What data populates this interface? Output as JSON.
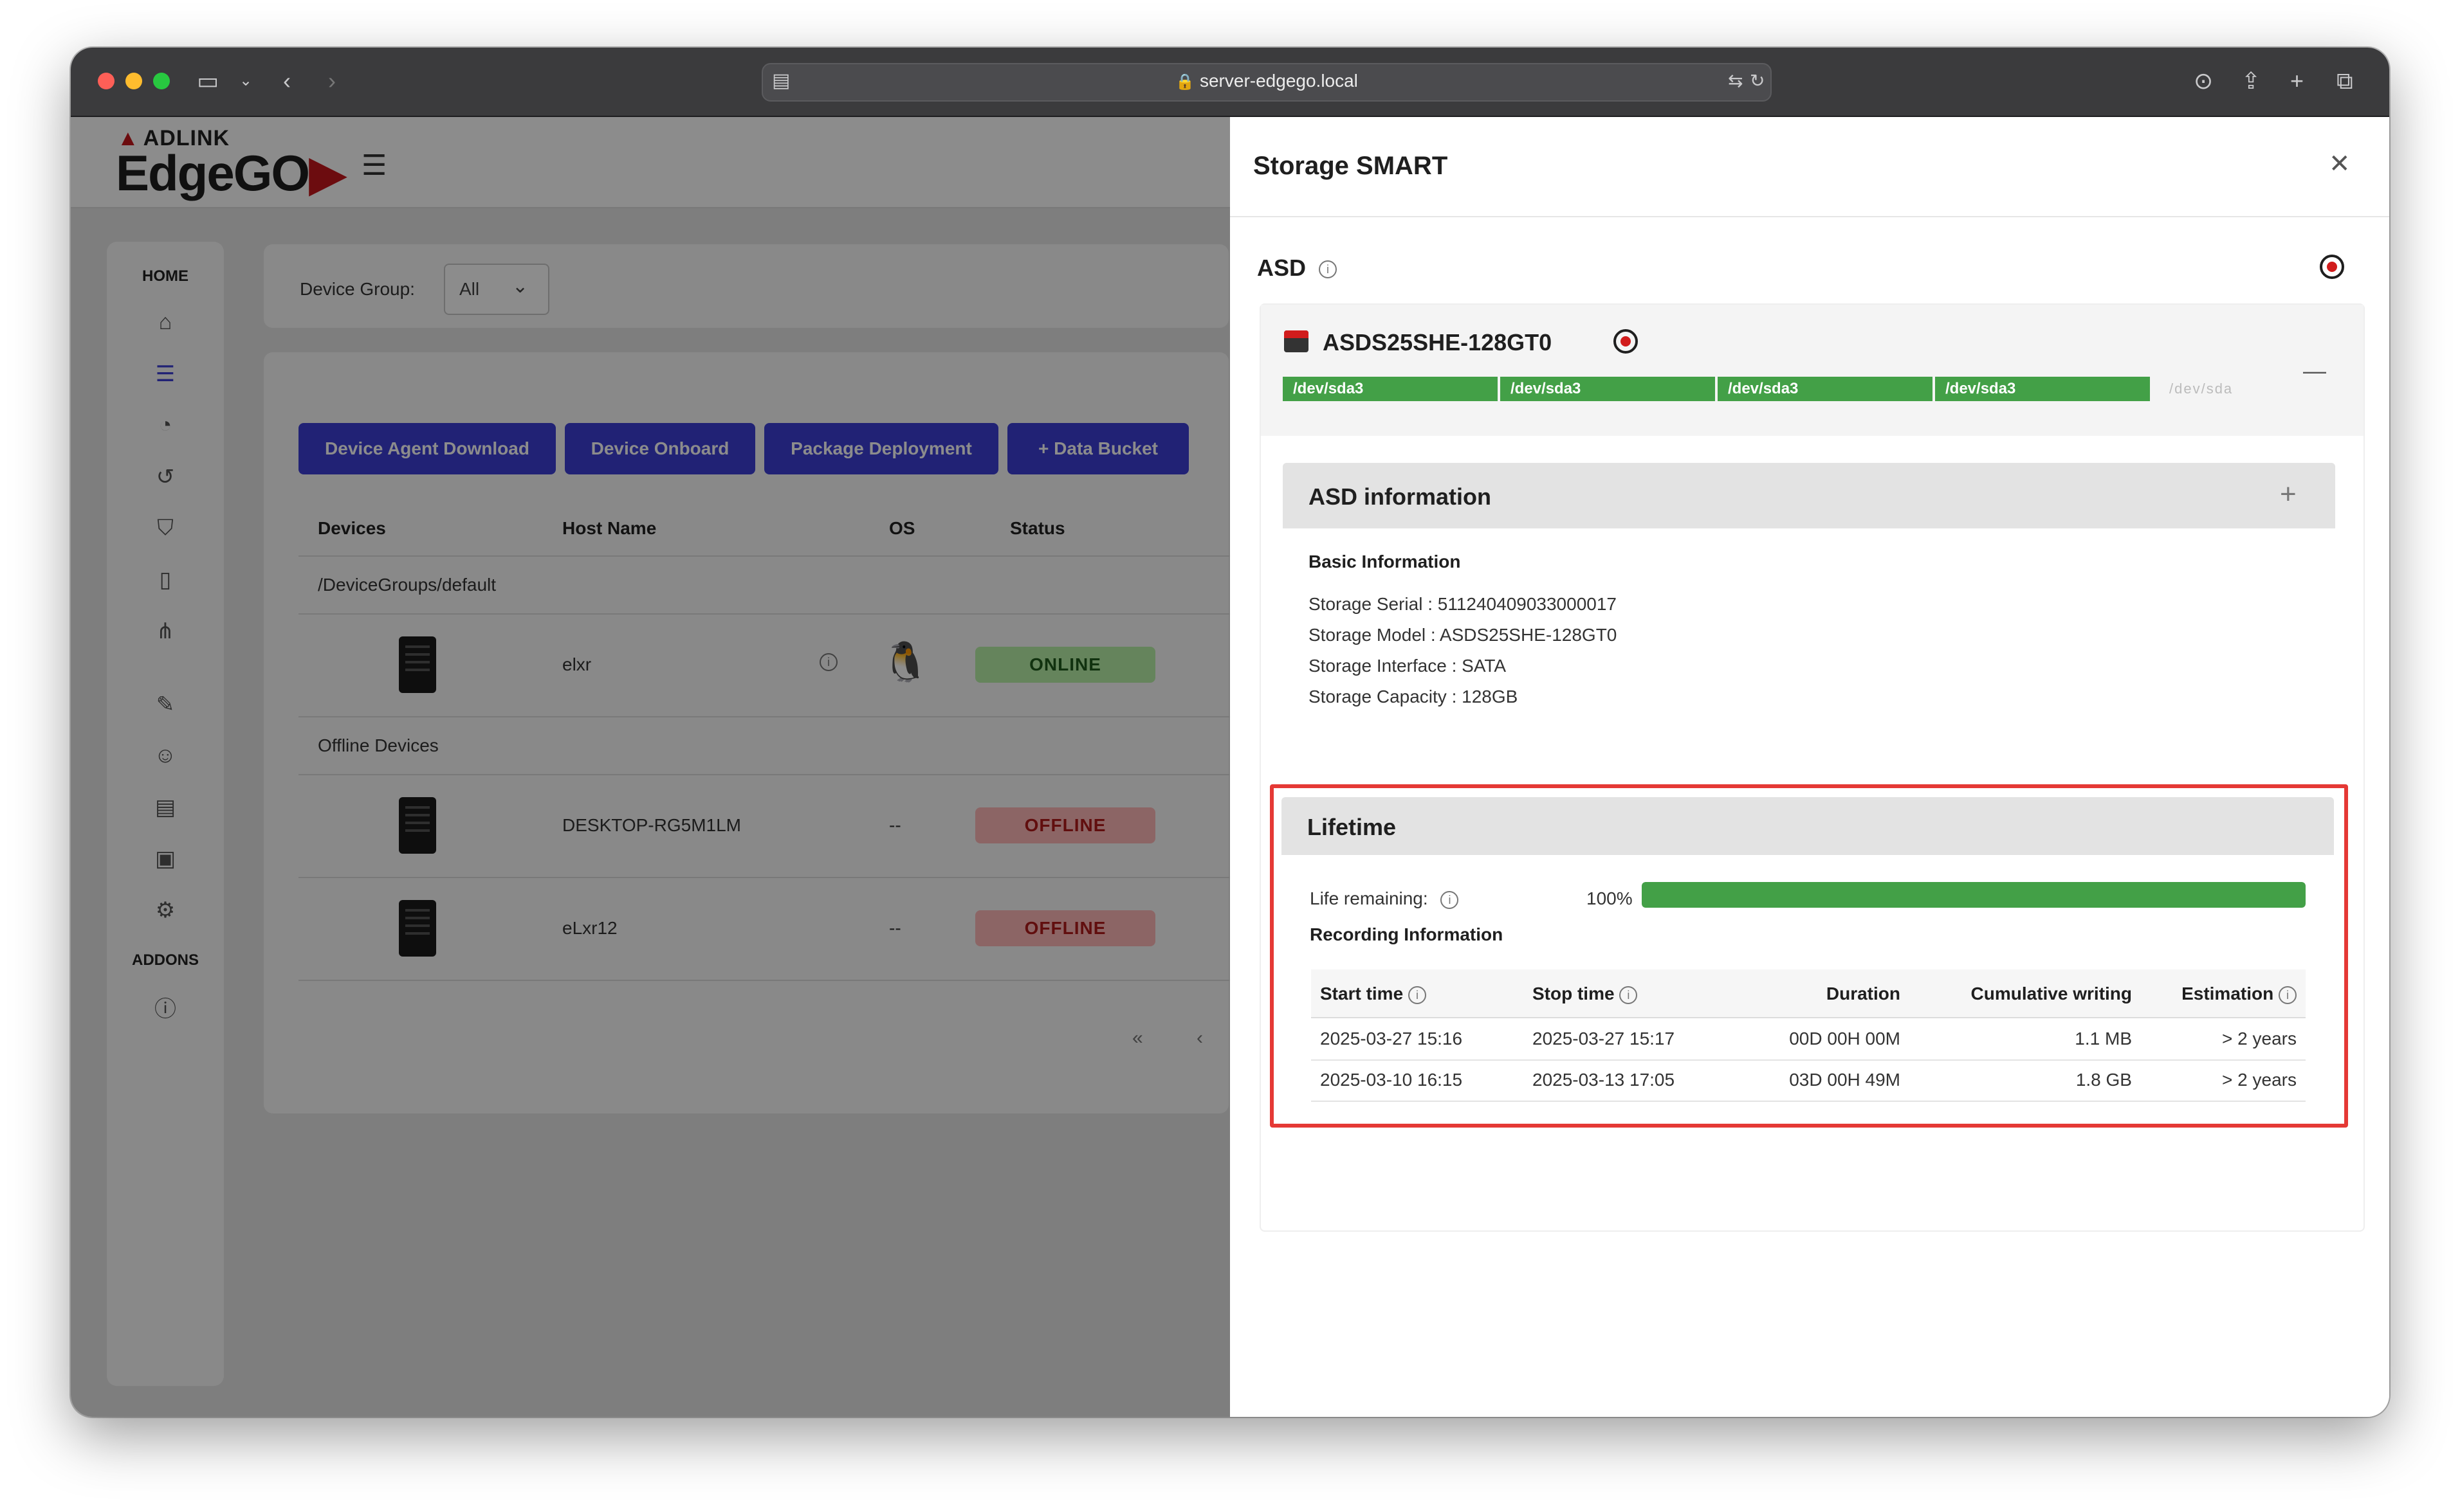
{
  "browser": {
    "url": "server-edgego.local"
  },
  "app": {
    "brand": "ADLINK",
    "logo_text": "EdgeGO",
    "sidebar": {
      "home_label": "HOME",
      "addons_label": "ADDONS",
      "items": [
        "home-icon",
        "list-icon",
        "bell-icon",
        "history-icon",
        "shield-icon",
        "file-icon",
        "network-icon",
        "user-edit-icon",
        "users-icon",
        "id-card-icon",
        "briefcase-icon",
        "gear-icon"
      ],
      "addon_items": [
        "info-icon"
      ]
    },
    "device_group": {
      "label": "Device Group:",
      "value": "All"
    },
    "toolbar": {
      "agent_download": "Device Agent Download",
      "onboard": "Device Onboard",
      "package": "Package Deployment",
      "bucket": "+ Data Bucket"
    },
    "table": {
      "headers": [
        "Devices",
        "Host Name",
        "OS",
        "Status"
      ],
      "group_online": "/DeviceGroups/default",
      "group_offline": "Offline Devices",
      "rows": [
        {
          "host": "elxr",
          "os": "",
          "status": "ONLINE"
        },
        {
          "host": "DESKTOP-RG5M1LM",
          "os": "--",
          "status": "OFFLINE"
        },
        {
          "host": "eLxr12",
          "os": "--",
          "status": "OFFLINE"
        }
      ],
      "pager": {
        "first": "«",
        "prev": "‹"
      }
    }
  },
  "drawer": {
    "title": "Storage SMART",
    "section_label": "ASD",
    "device": {
      "name": "ASDS25SHE-128GT0",
      "partitions": [
        "/dev/sda3",
        "/dev/sda3",
        "/dev/sda3",
        "/dev/sda3"
      ],
      "partition_faint": "/dev/sda"
    },
    "info": {
      "title": "ASD information",
      "basic_title": "Basic Information",
      "serial": "Storage Serial : 511240409033000017",
      "model": "Storage Model : ASDS25SHE-128GT0",
      "interface": "Storage Interface : SATA",
      "capacity": "Storage Capacity : 128GB"
    },
    "lifetime": {
      "title": "Lifetime",
      "life_label": "Life remaining:",
      "life_value": "100%",
      "life_fraction": 1.0,
      "recording_title": "Recording Information",
      "headers": {
        "start": "Start time",
        "stop": "Stop time",
        "duration": "Duration",
        "cumulative": "Cumulative writing",
        "estimation": "Estimation"
      },
      "rows": [
        {
          "start": "2025-03-27 15:16",
          "stop": "2025-03-27 15:17",
          "duration": "00D 00H 00M",
          "cumulative": "1.1 MB",
          "estimation": "> 2 years"
        },
        {
          "start": "2025-03-10 16:15",
          "stop": "2025-03-13 17:05",
          "duration": "03D 00H 49M",
          "cumulative": "1.8 GB",
          "estimation": "> 2 years"
        }
      ]
    },
    "colors": {
      "accent": "#3c3fd6",
      "success": "#43a047",
      "highlight": "#e53935",
      "online_bg": "#b8f0a8",
      "offline_bg": "#ffb8b8"
    }
  }
}
